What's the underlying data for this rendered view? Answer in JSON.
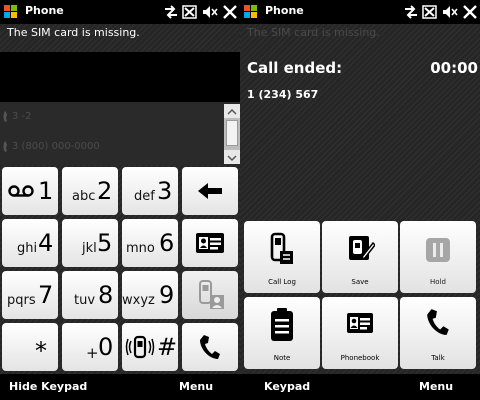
{
  "left": {
    "title": "Phone",
    "sim_message": "The SIM card is missing.",
    "call_list": [
      {
        "text": "3 -2",
        "icon": "phone-icon"
      },
      {
        "text": "3 (800) 000-0000",
        "icon": "phone-icon"
      }
    ],
    "keypad": [
      {
        "name": "key-1",
        "digit": "1",
        "letters": "",
        "icon": "voicemail-icon"
      },
      {
        "name": "key-2",
        "digit": "2",
        "letters": "abc"
      },
      {
        "name": "key-3",
        "digit": "3",
        "letters": "def"
      },
      {
        "name": "backspace-key",
        "icon": "backspace-arrow-icon"
      },
      {
        "name": "key-4",
        "digit": "4",
        "letters": "ghi"
      },
      {
        "name": "key-5",
        "digit": "5",
        "letters": "jkl"
      },
      {
        "name": "key-6",
        "digit": "6",
        "letters": "mno"
      },
      {
        "name": "contacts-key",
        "icon": "contact-card-icon"
      },
      {
        "name": "key-7",
        "digit": "7",
        "letters": "pqrs"
      },
      {
        "name": "key-8",
        "digit": "8",
        "letters": "tuv"
      },
      {
        "name": "key-9",
        "digit": "9",
        "letters": "wxyz"
      },
      {
        "name": "speed-dial-key",
        "icon": "phone-contact-icon"
      },
      {
        "name": "key-star",
        "digit": "*",
        "letters": ""
      },
      {
        "name": "key-0",
        "digit": "0",
        "letters": "+"
      },
      {
        "name": "key-hash",
        "digit": "#",
        "letters": "",
        "icon": "vibrate-icon"
      },
      {
        "name": "talk-key",
        "icon": "handset-icon"
      }
    ],
    "softkeys": {
      "left": "Hide Keypad",
      "right": "Menu"
    }
  },
  "right": {
    "title": "Phone",
    "sim_message": "The SIM card is missing.",
    "call_status": "Call ended:",
    "call_duration": "00:00",
    "number": "1 (234) 567",
    "actions": [
      {
        "name": "call-log-button",
        "label": "Call Log",
        "icon": "call-log-icon"
      },
      {
        "name": "save-button",
        "label": "Save",
        "icon": "save-contact-icon"
      },
      {
        "name": "hold-button",
        "label": "Hold",
        "icon": "pause-icon",
        "disabled": true
      },
      {
        "name": "note-button",
        "label": "Note",
        "icon": "note-icon"
      },
      {
        "name": "phonebook-button",
        "label": "Phonebook",
        "icon": "contact-card-icon"
      },
      {
        "name": "talk-button",
        "label": "Talk",
        "icon": "handset-icon"
      }
    ],
    "softkeys": {
      "left": "Keypad",
      "right": "Menu"
    }
  },
  "status_icons": [
    "connectivity-icon",
    "signal-off-icon",
    "speaker-mute-icon",
    "close-icon"
  ],
  "colors": {
    "background": "#262626",
    "key_face": "#ffffff",
    "muted_text": "#4c4c4c",
    "softbar": "#000000"
  }
}
